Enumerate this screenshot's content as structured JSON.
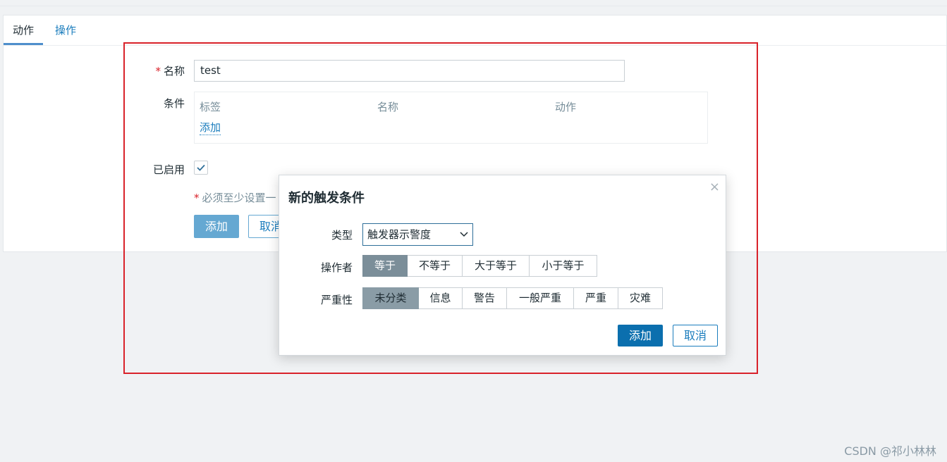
{
  "tabs": [
    "动作",
    "操作"
  ],
  "form": {
    "name_label": "名称",
    "required_mark": "*",
    "name_value": "test",
    "conditions_label": "条件",
    "conditions_headers": [
      "标签",
      "名称",
      "动作"
    ],
    "conditions_add": "添加",
    "enabled_label": "已启用",
    "enabled_checked": true,
    "note": "必须至少设置一",
    "add_button": "添加",
    "cancel_button": "取消"
  },
  "dialog": {
    "title": "新的触发条件",
    "close": "×",
    "type_label": "类型",
    "type_value": "触发器示警度",
    "operator_label": "操作者",
    "operators": [
      "等于",
      "不等于",
      "大于等于",
      "小于等于"
    ],
    "operator_selected": "等于",
    "severity_label": "严重性",
    "severities": [
      "未分类",
      "信息",
      "警告",
      "一般严重",
      "严重",
      "灾难"
    ],
    "severity_selected": "未分类",
    "add_button": "添加",
    "cancel_button": "取消"
  },
  "watermark": "CSDN @祁小林林",
  "colors": {
    "link": "#1b7dbd",
    "primary": "#0b6fae",
    "required": "#d9222a",
    "highlight_frame": "#d9222a",
    "selected_segment": "#7b8e99"
  }
}
